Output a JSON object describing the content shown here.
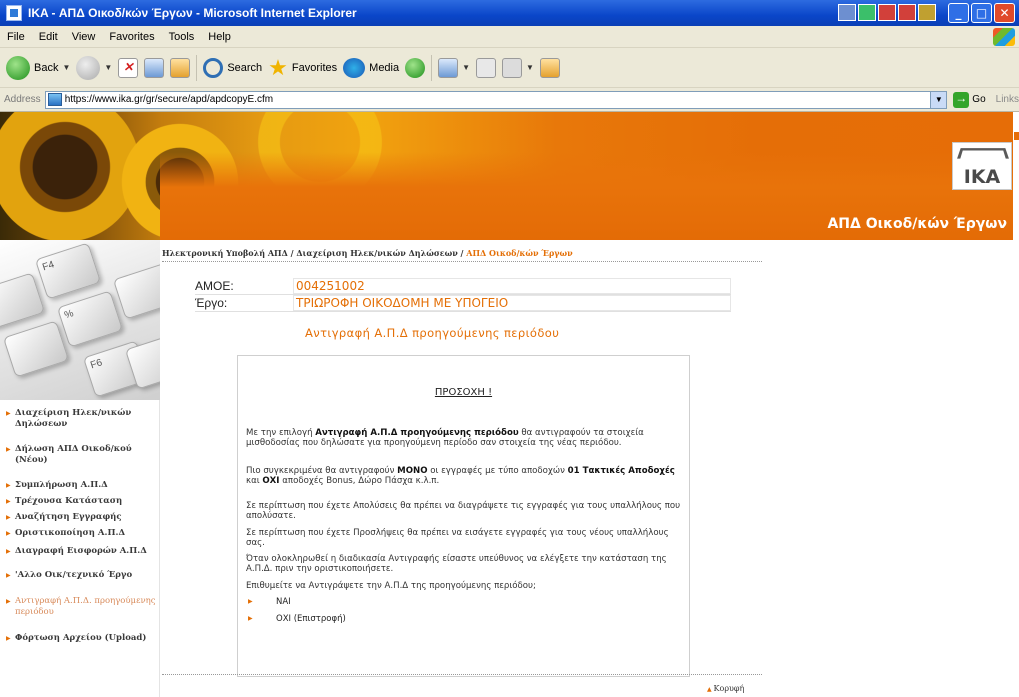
{
  "window": {
    "title": "IKA - ΑΠΔ Οικοδ/κών Έργων - Microsoft Internet Explorer",
    "controls": [
      "_",
      "□",
      "✕"
    ]
  },
  "menu": [
    "File",
    "Edit",
    "View",
    "Favorites",
    "Tools",
    "Help"
  ],
  "toolbar": {
    "back_label": "Back",
    "search_label": "Search",
    "favorites_label": "Favorites",
    "media_label": "Media"
  },
  "address": {
    "label": "Address",
    "url": "https://www.ika.gr/gr/secure/apd/apdcopyE.cfm",
    "go_label": "Go",
    "links_label": "Links"
  },
  "banner": {
    "logo_text": "IKA",
    "tagline": "ΑΠΔ Οικοδ/κών Έργων"
  },
  "keyboard_keys": [
    "F4",
    "%",
    "",
    "",
    "",
    "",
    "F6"
  ],
  "nav": [
    {
      "label": "Διαχείριση Ηλεκ/νικών Δηλώσεων",
      "active": false
    },
    {
      "label": "Δήλωση ΑΠΔ Οικοδ/κού (Νέου)",
      "active": false
    },
    {
      "label": "Συμπλήρωση Α.Π.Δ",
      "active": false
    },
    {
      "label": "Τρέχουσα Κατάσταση",
      "active": false
    },
    {
      "label": "Αναζήτηση Εγγραφής",
      "active": false
    },
    {
      "label": "Οριστικοποίηση Α.Π.Δ",
      "active": false
    },
    {
      "label": "Διαγραφή Εισφορών Α.Π.Δ",
      "active": false
    },
    {
      "label": "'Αλλο Οικ/τεχνικό Έργο",
      "active": false
    },
    {
      "label": "Αντιγραφή Α.Π.Δ. προηγούμενης περιόδου",
      "active": true
    },
    {
      "label": "Φόρτωση Αρχείου (Upload)",
      "active": false
    }
  ],
  "breadcrumb": {
    "part1": "Ηλεκτρονική Υποβολή ΑΠΔ",
    "sep": " / ",
    "part2": "Διαχείριση Ηλεκ/νικών Δηλώσεων",
    "current": "ΑΠΔ Οικοδ/κών Έργων"
  },
  "info": {
    "amoe_label": "ΑΜΟΕ:",
    "amoe_value": "004251002",
    "ergo_label": "Έργο:",
    "ergo_value": "ΤΡΙΩΡΟΦΗ ΟΙΚΟΔΟΜΗ ΜΕ ΥΠΟΓΕΙΟ"
  },
  "subtitle": "Αντιγραφή Α.Π.Δ προηγούμενης περιόδου",
  "notice": {
    "title": "ΠΡΟΣΟΧΗ !",
    "p1_pre": "Με την επιλογή ",
    "p1_bold": "Αντιγραφή Α.Π.Δ προηγούμενης περιόδου",
    "p1_post": " θα αντιγραφούν τα στοιχεία μισθοδοσίας που δηλώσατε για προηγούμενη περίοδο σαν στοιχεία της νέας περιόδου.",
    "p2_pre": "Πιο συγκεκριμένα θα αντιγραφούν ",
    "p2_bold1": "ΜΟΝΟ",
    "p2_mid": " οι εγγραφές με τύπο αποδοχών ",
    "p2_bold2": "01 Τακτικές Αποδοχές",
    "p2_mid2": " και ",
    "p2_bold3": "ΟΧΙ",
    "p2_post": " αποδοχές Bonus, Δώρο Πάσχα κ.λ.π.",
    "p3": "Σε περίπτωση που έχετε Απολύσεις θα πρέπει να διαγράψετε τις εγγραφές για τους υπαλλήλους που απολύσατε.",
    "p4": "Σε περίπτωση που έχετε Προσλήψεις θα πρέπει να εισάγετε εγγραφές για τους νέους υπαλλήλους σας.",
    "p5": "Όταν ολοκληρωθεί η διαδικασία Αντιγραφής είσαστε υπεύθυνος να ελέγξετε την κατάσταση της Α.Π.Δ. πριν την οριστικοποιήσετε.",
    "question": "Επιθυμείτε να Αντιγράψετε την Α.Π.Δ της προηγούμενης περιόδου;",
    "yes": "ΝΑΙ",
    "no": "ΟΧΙ (Επιστροφή)"
  },
  "top_link": "Κορυφή"
}
